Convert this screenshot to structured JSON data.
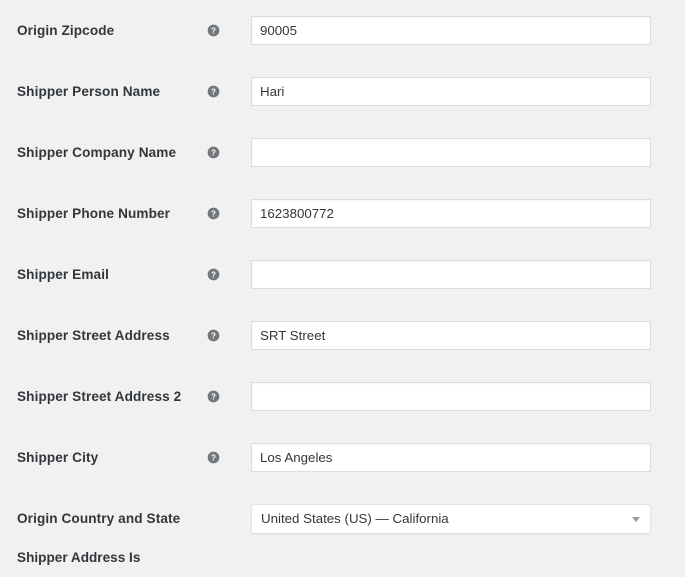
{
  "form": {
    "help_icon": "help-circle-icon",
    "dropdown_icon": "chevron-down-icon",
    "colors": {
      "page_background": "#f1f1f1",
      "label_text": "#32373c",
      "input_background": "#ffffff",
      "input_border": "#dddddd",
      "help_icon_fill": "#72777c",
      "select_arrow": "#9b9b9b"
    },
    "rows": [
      {
        "label": "Origin Zipcode",
        "control": "text",
        "value": "90005",
        "placeholder": "",
        "has_help": true
      },
      {
        "label": "Shipper Person Name",
        "control": "text",
        "value": "Hari",
        "placeholder": "",
        "has_help": true
      },
      {
        "label": "Shipper Company Name",
        "control": "text",
        "value": "",
        "placeholder": "",
        "has_help": true
      },
      {
        "label": "Shipper Phone Number",
        "control": "text",
        "value": "1623800772",
        "placeholder": "",
        "has_help": true
      },
      {
        "label": "Shipper Email",
        "control": "text",
        "value": "",
        "placeholder": "",
        "has_help": true
      },
      {
        "label": "Shipper Street Address",
        "control": "text",
        "value": "SRT Street",
        "placeholder": "",
        "has_help": true
      },
      {
        "label": "Shipper Street Address 2",
        "control": "text",
        "value": "",
        "placeholder": "",
        "has_help": true
      },
      {
        "label": "Shipper City",
        "control": "text",
        "value": "Los Angeles",
        "placeholder": "",
        "has_help": true
      },
      {
        "label": "Origin Country and State",
        "control": "select",
        "value": "United States (US) — California",
        "placeholder": "",
        "has_help": false
      }
    ],
    "cut_off_row": {
      "label": "Shipper Address Is"
    }
  }
}
